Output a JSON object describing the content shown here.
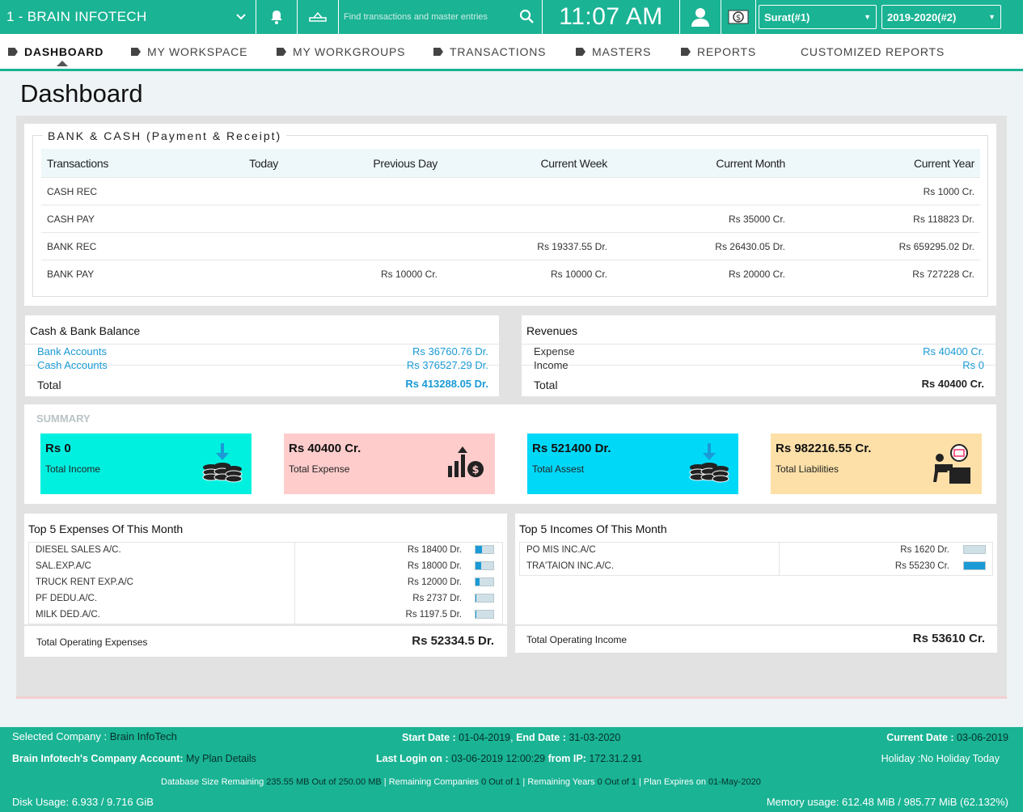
{
  "topbar": {
    "company": "1 - BRAIN INFOTECH",
    "search_placeholder": "Find transactions and master entries",
    "clock": "11:07 AM",
    "branch": "Surat(#1)",
    "year": "2019-2020(#2)"
  },
  "nav": {
    "items": [
      "DASHBOARD",
      "MY WORKSPACE",
      "MY WORKGROUPS",
      "TRANSACTIONS",
      "MASTERS",
      "REPORTS",
      "CUSTOMIZED REPORTS"
    ]
  },
  "page_title": "Dashboard",
  "bank_cash": {
    "legend": "BANK & CASH (Payment & Receipt)",
    "headers": [
      "Transactions",
      "Today",
      "Previous Day",
      "Current Week",
      "Current Month",
      "Current Year"
    ],
    "rows": [
      [
        "CASH REC",
        "",
        "",
        "",
        "",
        "Rs 1000 Cr."
      ],
      [
        "CASH PAY",
        "",
        "",
        "",
        "Rs 35000 Cr.",
        "Rs 118823 Dr."
      ],
      [
        "BANK REC",
        "",
        "",
        "Rs 19337.55 Dr.",
        "Rs 26430.05 Dr.",
        "Rs 659295.02 Dr."
      ],
      [
        "BANK PAY",
        "",
        "Rs 10000 Cr.",
        "Rs 10000 Cr.",
        "Rs 20000 Cr.",
        "Rs 727228 Cr."
      ]
    ]
  },
  "balance": {
    "title": "Cash & Bank Balance",
    "bank_label": "Bank Accounts",
    "bank_value": "Rs 36760.76 Dr.",
    "cash_label": "Cash Accounts",
    "cash_value": "Rs 376527.29 Dr.",
    "total_label": "Total",
    "total_value": "Rs 413288.05 Dr."
  },
  "revenues": {
    "title": "Revenues",
    "expense_label": "Expense",
    "expense_value": "Rs 40400 Cr.",
    "income_label": "Income",
    "income_value": "Rs 0",
    "total_label": "Total",
    "total_value": "Rs 40400 Cr."
  },
  "summary": {
    "label": "SUMMARY",
    "tiles": [
      {
        "value": "Rs 0",
        "label": "Total Income",
        "color": "#00f0e0",
        "icon": "coins-down-icon"
      },
      {
        "value": "Rs 40400 Cr.",
        "label": "Total Expense",
        "color": "#ffcccc",
        "icon": "growth-dollar-icon"
      },
      {
        "value": "Rs 521400 Dr.",
        "label": "Total Assest",
        "color": "#00d8f8",
        "icon": "coins-down-icon"
      },
      {
        "value": "Rs 982216.55 Cr.",
        "label": "Total Liabilities",
        "color": "#fde0a8",
        "icon": "person-desk-icon"
      }
    ]
  },
  "top_expenses": {
    "title": "Top 5 Expenses Of This Month",
    "rows": [
      {
        "name": "DIESEL SALES A/C.",
        "amount": "Rs 18400 Dr.",
        "share": 0.35
      },
      {
        "name": "SAL.EXP.A/C",
        "amount": "Rs 18000 Dr.",
        "share": 0.34
      },
      {
        "name": "TRUCK RENT EXP.A/C",
        "amount": "Rs 12000 Dr.",
        "share": 0.23
      },
      {
        "name": "PF DEDU.A/C.",
        "amount": "Rs 2737 Dr.",
        "share": 0.05
      },
      {
        "name": "MILK DED.A/C.",
        "amount": "Rs 1197.5 Dr.",
        "share": 0.02
      }
    ],
    "total_label": "Total Operating Expenses",
    "total_value": "Rs 52334.5 Dr."
  },
  "top_incomes": {
    "title": "Top 5 Incomes Of This Month",
    "rows": [
      {
        "name": "PO MIS INC.A/C",
        "amount": "Rs 1620 Dr.",
        "share": 0.03
      },
      {
        "name": "TRA'TAION INC.A/C.",
        "amount": "Rs 55230 Cr.",
        "share": 1.0
      }
    ],
    "total_label": "Total Operating Income",
    "total_value": "Rs 53610 Cr."
  },
  "footer": {
    "selected_company_label": "Selected Company :",
    "selected_company": "Brain InfoTech",
    "start_label": "Start Date :",
    "start_date": "01-04-2019",
    "end_label": "End Date :",
    "end_date": "31-03-2020",
    "current_label": "Current Date :",
    "current_date": "03-06-2019",
    "account_label": "Brain Infotech's Company Account:",
    "account_link": "My Plan Details",
    "login_label": "Last Login on :",
    "login_value": "03-06-2019 12:00:29",
    "ip_label": "from IP:",
    "ip_value": "172.31.2.91",
    "holiday": "Holiday :No Holiday Today",
    "db_label": "Database Size Remaining",
    "db_value": "235.55 MB Out of 250.00 MB",
    "rc_label": "Remaining Companies",
    "rc_value": "0 Out of 1",
    "ry_label": "Remaining Years",
    "ry_value": "0 Out of 1",
    "pe_label": "Plan Expires on",
    "pe_value": "01-May-2020",
    "disk": "Disk Usage: 6.933 / 9.716 GiB",
    "memory": "Memory usage: 612.48 MiB / 985.77 MiB (62.132%)"
  }
}
